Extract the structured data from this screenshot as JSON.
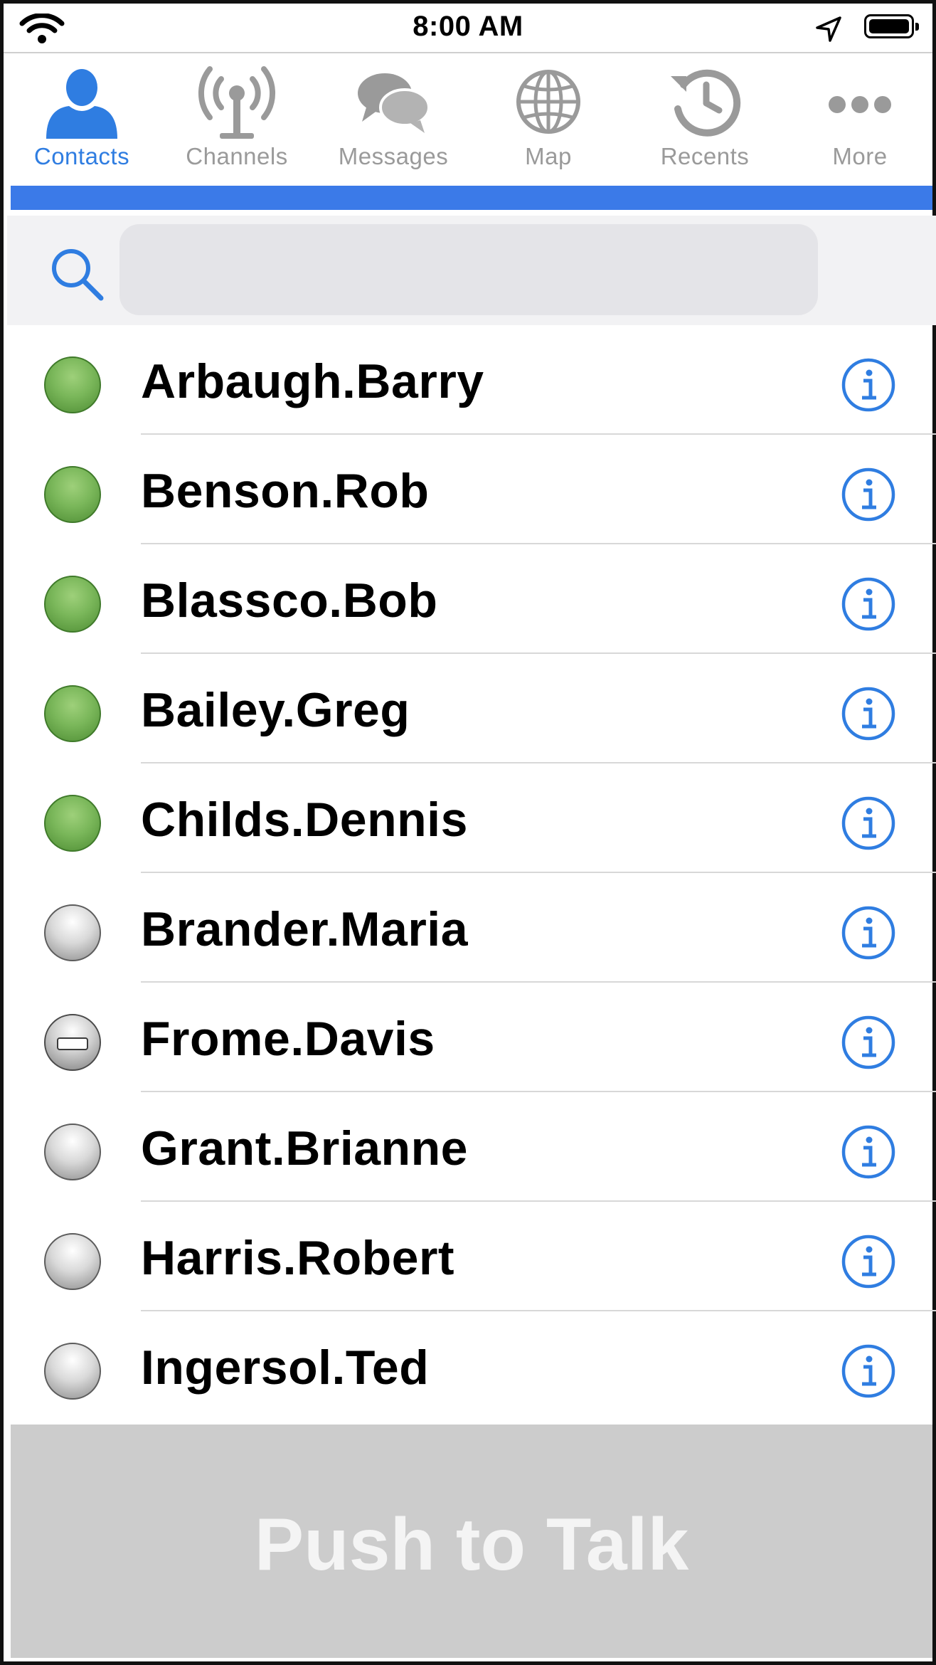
{
  "status_bar": {
    "time": "8:00 AM",
    "icons": [
      "wifi-icon",
      "location-arrow-icon",
      "battery-icon"
    ]
  },
  "tabs": [
    {
      "label": "Contacts",
      "icon": "person-icon",
      "active": true
    },
    {
      "label": "Channels",
      "icon": "antenna-icon",
      "active": false
    },
    {
      "label": "Messages",
      "icon": "chat-bubbles-icon",
      "active": false
    },
    {
      "label": "Map",
      "icon": "globe-icon",
      "active": false
    },
    {
      "label": "Recents",
      "icon": "history-clock-icon",
      "active": false
    },
    {
      "label": "More",
      "icon": "ellipsis-icon",
      "active": false
    }
  ],
  "search": {
    "value": "",
    "placeholder": ""
  },
  "contacts": [
    {
      "name": "Arbaugh.Barry",
      "status": "available"
    },
    {
      "name": "Benson.Rob",
      "status": "available"
    },
    {
      "name": "Blassco.Bob",
      "status": "available"
    },
    {
      "name": "Bailey.Greg",
      "status": "available"
    },
    {
      "name": "Childs.Dennis",
      "status": "available"
    },
    {
      "name": "Brander.Maria",
      "status": "offline"
    },
    {
      "name": "Frome.Davis",
      "status": "dnd"
    },
    {
      "name": "Grant.Brianne",
      "status": "offline"
    },
    {
      "name": "Harris.Robert",
      "status": "offline"
    },
    {
      "name": "Ingersol.Ted",
      "status": "offline"
    }
  ],
  "colors": {
    "accent": "#2f7de1",
    "tab_underline": "#3b7ae8",
    "inactive_tab": "#9a9a9a",
    "available": "#7ab75a",
    "push_to_talk_bg": "#cccccc"
  },
  "push_to_talk": {
    "label": "Push to Talk"
  }
}
